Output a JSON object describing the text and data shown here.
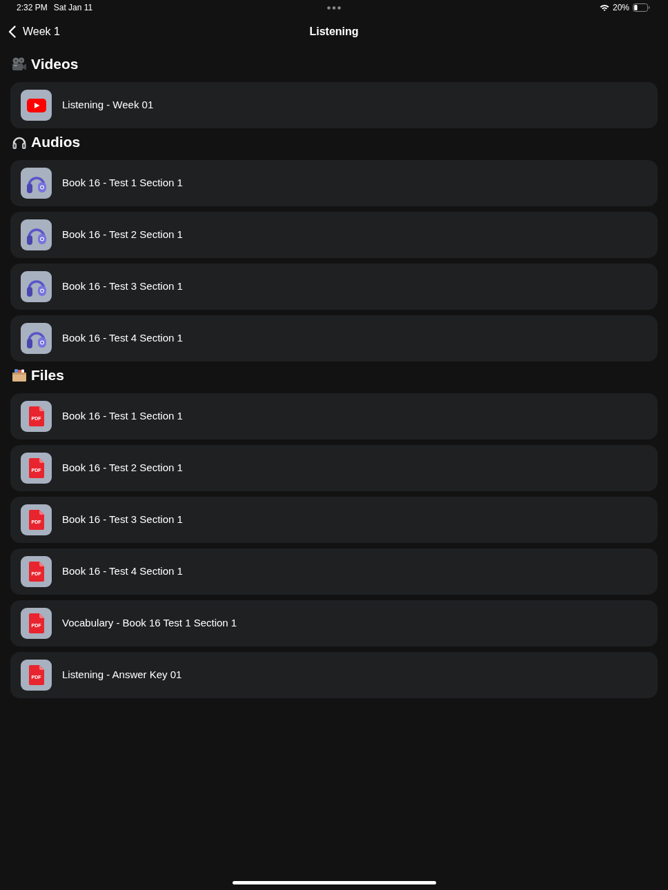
{
  "status_bar": {
    "time": "2:32 PM",
    "date": "Sat Jan 11",
    "battery": "20%"
  },
  "nav": {
    "back": "Week 1",
    "title": "Listening"
  },
  "sections": [
    {
      "kind": "videos",
      "title": "Videos",
      "items": [
        {
          "kind": "video",
          "title": "Listening - Week 01"
        }
      ]
    },
    {
      "kind": "audios",
      "title": "Audios",
      "items": [
        {
          "kind": "audio",
          "title": "Book 16 - Test 1 Section 1"
        },
        {
          "kind": "audio",
          "title": "Book 16 - Test 2 Section 1"
        },
        {
          "kind": "audio",
          "title": "Book 16 - Test 3 Section 1"
        },
        {
          "kind": "audio",
          "title": "Book 16 - Test 4 Section 1"
        }
      ]
    },
    {
      "kind": "files",
      "title": "Files",
      "items": [
        {
          "kind": "pdf",
          "badge": "PDF",
          "title": "Book 16 - Test 1 Section 1"
        },
        {
          "kind": "pdf",
          "badge": "PDF",
          "title": "Book 16 - Test 2 Section 1"
        },
        {
          "kind": "pdf",
          "badge": "PDF",
          "title": "Book 16 - Test 3 Section 1"
        },
        {
          "kind": "pdf",
          "badge": "PDF",
          "title": "Book 16 - Test 4 Section 1"
        },
        {
          "kind": "pdf",
          "badge": "PDF",
          "title": "Vocabulary - Book 16 Test 1 Section 1"
        },
        {
          "kind": "pdf",
          "badge": "PDF",
          "title": "Listening - Answer Key 01"
        }
      ]
    }
  ]
}
